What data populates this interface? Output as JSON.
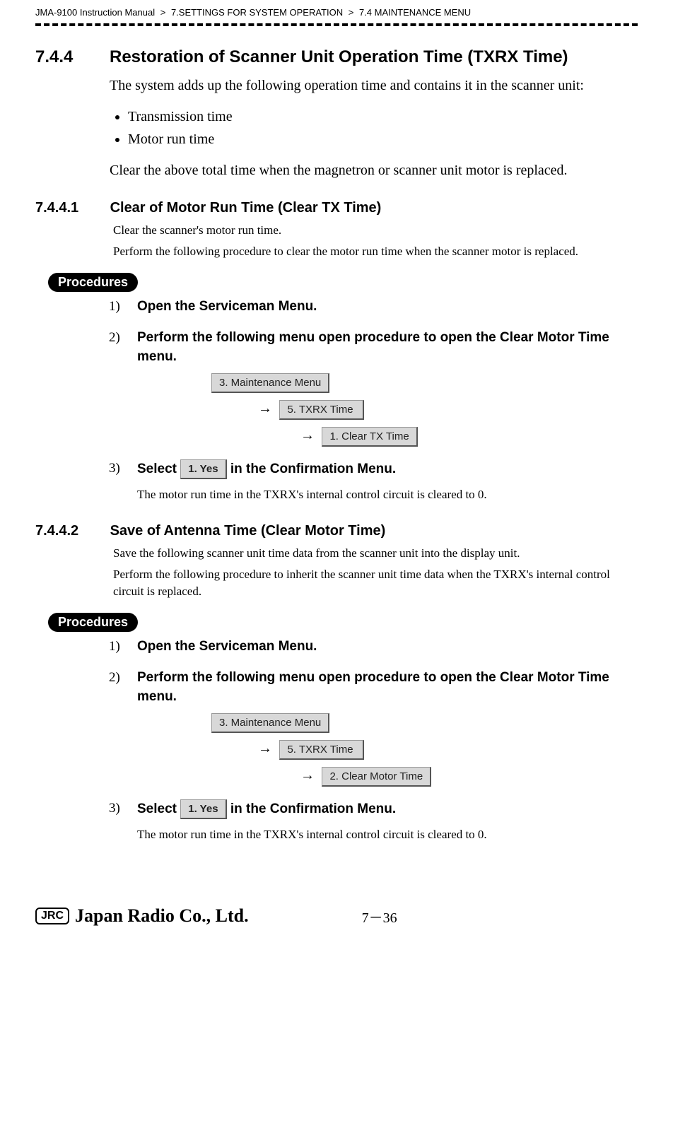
{
  "header": {
    "manual": "JMA-9100 Instruction Manual",
    "chapter": "7.SETTINGS FOR SYSTEM OPERATION",
    "section": "7.4  MAINTENANCE MENU"
  },
  "sec744": {
    "num": "7.4.4",
    "title": "Restoration of Scanner Unit Operation Time  (TXRX Time)",
    "intro": "The system adds up the following operation time and contains it in the scanner unit:",
    "bullets": [
      "Transmission time",
      "Motor run time"
    ],
    "clear_note": "Clear the above total time when the magnetron or scanner unit motor is replaced."
  },
  "sec7441": {
    "num": "7.4.4.1",
    "title": "Clear of Motor Run Time (Clear TX Time)",
    "p1": "Clear the scanner's motor run time.",
    "p2": "Perform the following procedure to clear the motor run time when the scanner motor is replaced.",
    "proc_label": "Procedures",
    "steps": {
      "s1": "Open the Serviceman Menu.",
      "s2": "Perform the following menu open procedure to open the Clear Motor Time menu.",
      "path": [
        "3. Maintenance Menu",
        "5. TXRX Time",
        "1. Clear TX Time"
      ],
      "s3_pre": "Select ",
      "s3_btn": "1. Yes",
      "s3_post": " in the Confirmation Menu.",
      "s3_note": "The motor run time in the TXRX's internal control circuit is cleared to 0."
    }
  },
  "sec7442": {
    "num": "7.4.4.2",
    "title": "Save of Antenna Time  (Clear Motor Time)",
    "p1": "Save the following scanner unit time data from the scanner unit into the display unit.",
    "p2": "Perform the following procedure to inherit the scanner unit time data when the TXRX's internal control circuit is replaced.",
    "proc_label": "Procedures",
    "steps": {
      "s1": "Open the Serviceman Menu.",
      "s2": "Perform the following menu open procedure to open the Clear Motor Time menu.",
      "path": [
        "3. Maintenance Menu",
        "5. TXRX Time",
        "2. Clear Motor Time"
      ],
      "s3_pre": "Select ",
      "s3_btn": "1. Yes",
      "s3_post": " in the Confirmation Menu.",
      "s3_note": "The motor run time in the TXRX's internal control circuit is cleared to 0."
    }
  },
  "footer": {
    "logo_box": "JRC",
    "logo_script": "Japan Radio Co., Ltd.",
    "page": "7－36"
  }
}
